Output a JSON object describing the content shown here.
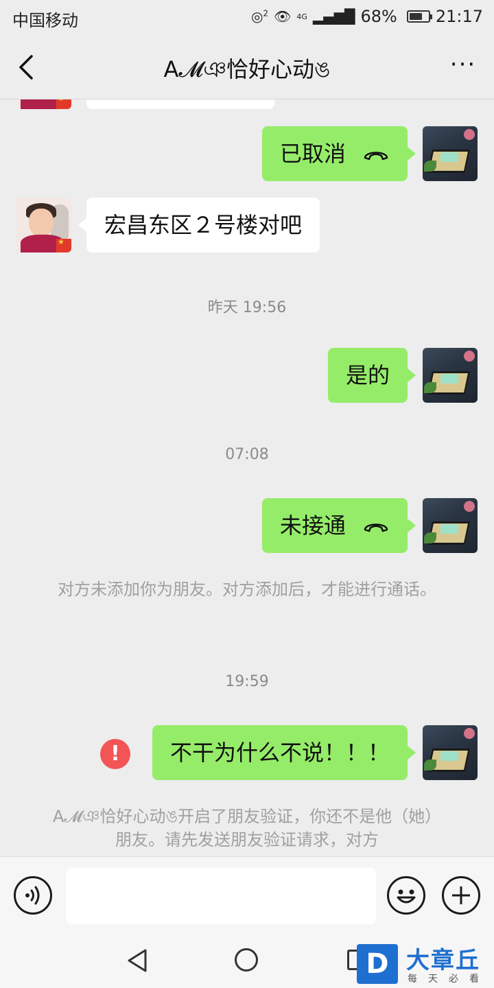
{
  "status_bar": {
    "carrier": "中国移动",
    "battery": "68%",
    "battery_level": 0.68,
    "time": "21:17",
    "network": "4G",
    "hotspot_badge": "2"
  },
  "header": {
    "title": "A𝓜ঞ恰好心动ঙ",
    "back_icon": "back-chevron-icon",
    "more_icon": "more-dots-icon",
    "more_label": "···"
  },
  "messages": [
    {
      "type": "outgoing",
      "text": "已取消",
      "icon": "hangup-icon"
    },
    {
      "type": "incoming",
      "text": "宏昌东区２号楼对吧"
    },
    {
      "type": "timestamp",
      "text": "昨天 19:56"
    },
    {
      "type": "outgoing",
      "text": "是的"
    },
    {
      "type": "timestamp",
      "text": "07:08"
    },
    {
      "type": "outgoing",
      "text": "未接通",
      "icon": "hangup-icon"
    },
    {
      "type": "system",
      "text": "对方未添加你为朋友。对方添加后，才能进行通话。"
    },
    {
      "type": "timestamp",
      "text": "19:59"
    },
    {
      "type": "outgoing",
      "text": "不干为什么不说！！！",
      "status": "failed",
      "status_icon": "!"
    },
    {
      "type": "system",
      "text": "A𝓜ঞ恰好心动ঙ开启了朋友验证，你还不是他（她）朋友。请先发送朋友验证请求，对方"
    }
  ],
  "input_bar": {
    "voice_icon": "voice-icon",
    "emoji_icon": "emoji-icon",
    "plus_icon": "plus-icon",
    "placeholder": ""
  },
  "nav_bar": {
    "back_icon": "nav-back-icon",
    "home_icon": "nav-home-icon",
    "recent_icon": "nav-recent-icon"
  },
  "watermark": {
    "logo": "D",
    "name": "大章丘",
    "tagline": "每天必看"
  },
  "colors": {
    "outgoing_bubble": "#95ec69",
    "incoming_bubble": "#ffffff",
    "background": "#ededed",
    "error": "#f35456"
  }
}
